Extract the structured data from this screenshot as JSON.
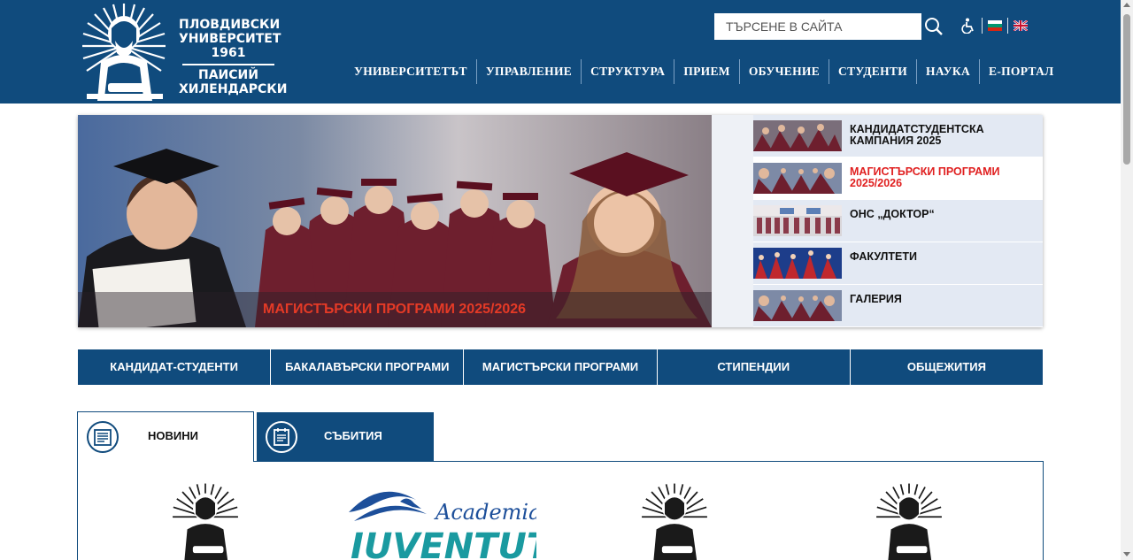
{
  "header": {
    "logo_lines": [
      "ПЛОВДИВСКИ",
      "УНИВЕРСИТЕТ",
      "1961",
      "ПАИСИЙ",
      "ХИЛЕНДАРСКИ"
    ],
    "search_placeholder": "ТЪРСЕНЕ В САЙТА",
    "icons": [
      "accessibility-icon",
      "bulgarian-flag-icon",
      "english-flag-icon",
      "search-icon"
    ]
  },
  "nav": {
    "items": [
      "УНИВЕРСИТЕТЪТ",
      "УПРАВЛЕНИЕ",
      "СТРУКТУРА",
      "ПРИЕМ",
      "ОБУЧЕНИЕ",
      "СТУДЕНТИ",
      "НАУКА",
      "Е-ПОРТАЛ"
    ]
  },
  "slider": {
    "caption": "МАГИСТЪРСКИ ПРОГРАМИ 2025/2026",
    "thumbs": [
      {
        "label": "КАНДИДАТСТУДЕНТСКА КАМПАНИЯ 2025",
        "active": false
      },
      {
        "label": "МАГИСТЪРСКИ ПРОГРАМИ 2025/2026",
        "active": true
      },
      {
        "label": "ОНС „ДОКТОР“",
        "active": false
      },
      {
        "label": "ФАКУЛТЕТИ",
        "active": false
      },
      {
        "label": "ГАЛЕРИЯ",
        "active": false
      }
    ]
  },
  "quick_links": [
    "КАНДИДАТ-СТУДЕНТИ",
    "БАКАЛАВЪРСКИ ПРОГРАМИ",
    "МАГИСТЪРСКИ ПРОГРАМИ",
    "СТИПЕНДИИ",
    "ОБЩЕЖИТИЯ"
  ],
  "tabs": {
    "news": "НОВИНИ",
    "events": "СЪБИТИЯ"
  },
  "news_logos": {
    "academia_word": "Academia",
    "iuventutis_word": "IUVENTUTIS"
  },
  "colors": {
    "primary": "#104b7d",
    "accent_red": "#e02020",
    "white": "#ffffff"
  }
}
